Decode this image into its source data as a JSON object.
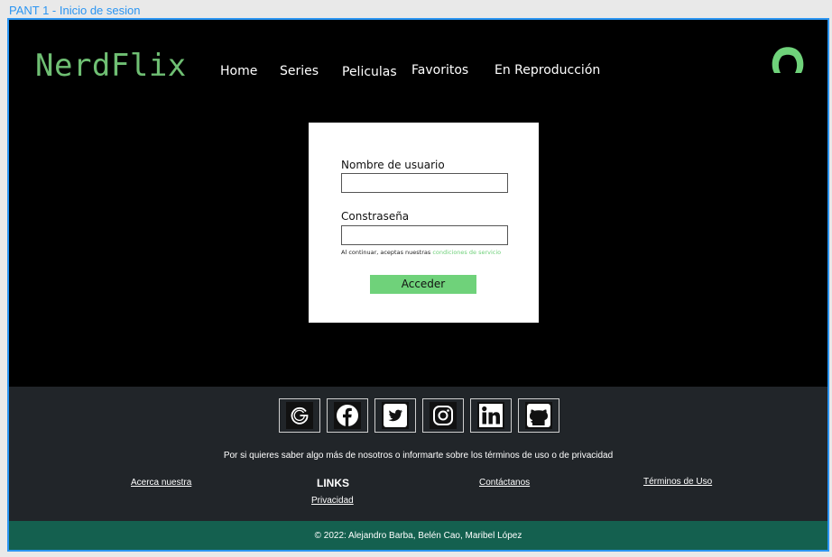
{
  "frame_label": "PANT 1 - Inicio de sesion",
  "header": {
    "logo": "NerdFlix",
    "nav": [
      "Home",
      "Series",
      "Peliculas",
      "Favoritos",
      "En Reproducción"
    ],
    "avatar_icon": "user-avatar-icon",
    "accent_color": "#6fbf73"
  },
  "login": {
    "username_label": "Nombre de usuario",
    "username_value": "",
    "password_label": "Constraseña",
    "password_value": "",
    "terms_text": "Al continuar, aceptas nuestras",
    "terms_link": "condiciones de servicio",
    "submit_label": "Acceder",
    "button_color": "#6fd27a"
  },
  "footer": {
    "social": [
      "google-icon",
      "facebook-icon",
      "twitter-icon",
      "instagram-icon",
      "linkedin-icon",
      "github-icon"
    ],
    "text": "Por si quieres saber algo más de nosotros o informarte sobre los términos de uso o de privacidad",
    "links_heading": "LINKS",
    "links": {
      "about": "Acerca nuestra",
      "privacy": "Privacidad",
      "contact": "Contáctanos",
      "terms": "Términos de Uso"
    },
    "copyright": "© 2022: Alejandro Barba, Belén Cao, Maribel López",
    "background": "#212529",
    "copyright_background": "#14604f"
  }
}
